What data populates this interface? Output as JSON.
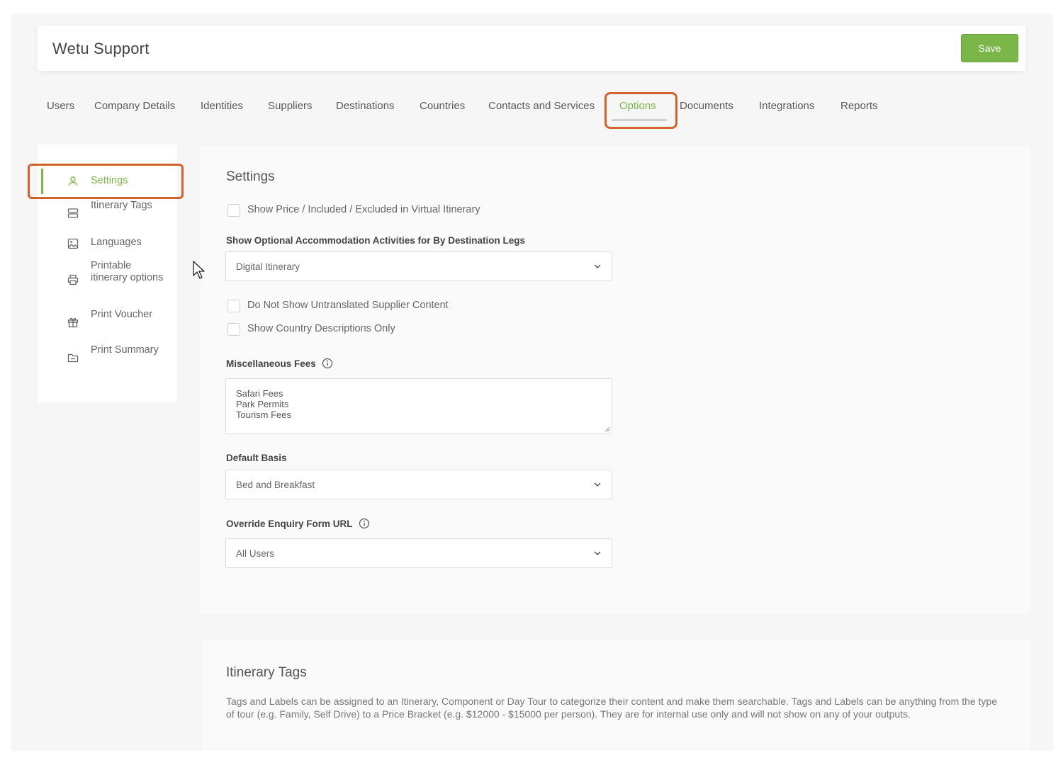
{
  "header": {
    "title": "Wetu Support",
    "save_label": "Save"
  },
  "tabs": [
    {
      "label": "Users"
    },
    {
      "label": "Company Details"
    },
    {
      "label": "Identities"
    },
    {
      "label": "Suppliers"
    },
    {
      "label": "Destinations"
    },
    {
      "label": "Countries"
    },
    {
      "label": "Contacts and Services"
    },
    {
      "label": "Options",
      "active": true
    },
    {
      "label": "Documents"
    },
    {
      "label": "Integrations"
    },
    {
      "label": "Reports"
    }
  ],
  "sidebar": {
    "items": [
      {
        "label": "Settings",
        "icon": "user-icon",
        "active": true
      },
      {
        "label": "Itinerary Tags",
        "icon": "tags-icon"
      },
      {
        "label": "Languages",
        "icon": "image-icon"
      },
      {
        "label": "Printable itinerary options",
        "icon": "printer-icon"
      },
      {
        "label": "Print Voucher",
        "icon": "gift-icon"
      },
      {
        "label": "Print Summary",
        "icon": "folder-icon"
      }
    ]
  },
  "settings": {
    "title": "Settings",
    "check_price": "Show Price / Included / Excluded in Virtual Itinerary",
    "optional_label": "Show Optional Accommodation Activities for By Destination Legs",
    "optional_value": "Digital Itinerary",
    "check_untranslated": "Do Not Show Untranslated Supplier Content",
    "check_country": "Show Country Descriptions Only",
    "misc_label": "Miscellaneous Fees",
    "misc_lines": [
      "Safari Fees",
      "Park Permits",
      "Tourism Fees"
    ],
    "basis_label": "Default Basis",
    "basis_value": "Bed and Breakfast",
    "override_label": "Override Enquiry Form URL",
    "override_value": "All Users"
  },
  "itinerary_tags": {
    "title": "Itinerary Tags",
    "description": "Tags and Labels can be assigned to an Itinerary, Component or Day Tour to categorize their content and make them searchable. Tags and Labels can be anything from the type of tour (e.g. Family, Self Drive) to a Price Bracket (e.g. $12000 - $15000 per person). They are for internal use only and will not show on any of your outputs."
  },
  "colors": {
    "accent": "#7ab648",
    "highlight": "#d2622a"
  }
}
